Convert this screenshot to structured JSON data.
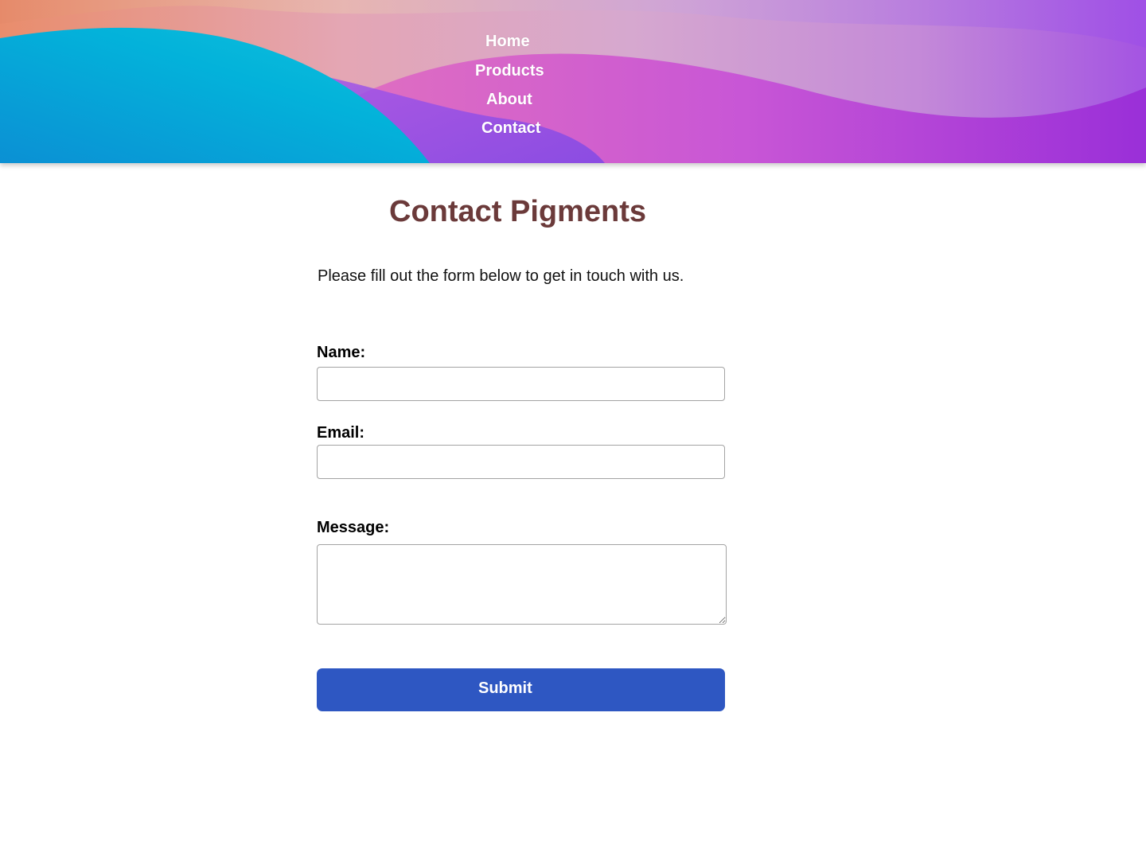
{
  "nav": {
    "items": [
      {
        "label": "Home"
      },
      {
        "label": "Products"
      },
      {
        "label": "About"
      },
      {
        "label": "Contact"
      }
    ]
  },
  "main": {
    "title": "Contact Pigments",
    "intro": "Please fill out the form below to get in touch with us."
  },
  "form": {
    "name_label": "Name:",
    "name_value": "",
    "email_label": "Email:",
    "email_value": "",
    "message_label": "Message:",
    "message_value": "",
    "submit_label": "Submit"
  },
  "colors": {
    "title": "#6b3a3a",
    "submit_button": "#2e57c2",
    "nav_text": "#ffffff"
  }
}
